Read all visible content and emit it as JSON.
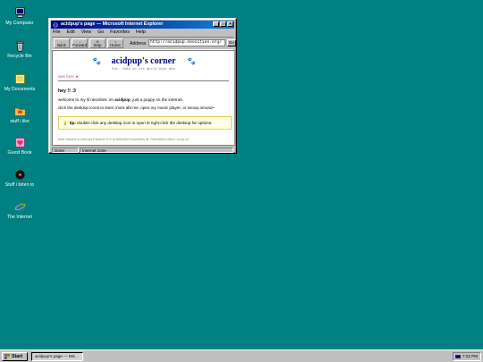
{
  "desktop": {
    "icons": [
      {
        "label": "My Computer",
        "icon": "my-computer-icon"
      },
      {
        "label": "Recycle Bin",
        "icon": "recycle-bin-icon"
      },
      {
        "label": "My Documents",
        "icon": "my-documents-icon"
      },
      {
        "label": "stuff i like",
        "icon": "folder-icon"
      },
      {
        "label": "Guest Book",
        "icon": "guestbook-heart-icon"
      },
      {
        "label": "Stuff i listen to",
        "icon": "music-player-icon"
      },
      {
        "label": "The Internet",
        "icon": "internet-explorer-icon"
      }
    ],
    "background_color": "#008080"
  },
  "window": {
    "title": "acidpup's page — Microsoft Internet Explorer",
    "controls": {
      "minimize": "_",
      "maximize": "□",
      "close": "×"
    },
    "menu": [
      "File",
      "Edit",
      "View",
      "Go",
      "Favorites",
      "Help"
    ],
    "toolbar": {
      "back": "Back",
      "forward": "Forward",
      "stop": "Stop",
      "home": "Home",
      "address_label": "Address",
      "address_value": "http://acidpup.neocities.org/",
      "go": "Go"
    },
    "page": {
      "title": "acidpup's corner",
      "subtitle": "Est. 1998 on the World Wide Web",
      "was_here": "was here ★",
      "greeting": "hey !! :3",
      "line1_prefix": "welcome to my lil neocities. im ",
      "line1_name": "acidpup",
      "line1_suffix": ", just a puppy on the internet.",
      "line2": "click the desktop icons to learn more abt me, open my music player, or snoop around~",
      "tip_label": "tip:",
      "tip_text": " double-click any desktop icon to open it! right-click the desktop for options.",
      "footer_note": "best viewed in Internet Explorer 5.0 at 800x600 resolution ★ ©neocities users: sorry lol"
    },
    "status": {
      "left": "Done",
      "zone": "Internet zone"
    }
  },
  "taskbar": {
    "start": "Start",
    "task": "acidpup's page — Mic...",
    "clock": "7:22 PM"
  },
  "colors": {
    "title_blue": "#000080",
    "accent_pink": "#d0508a"
  }
}
